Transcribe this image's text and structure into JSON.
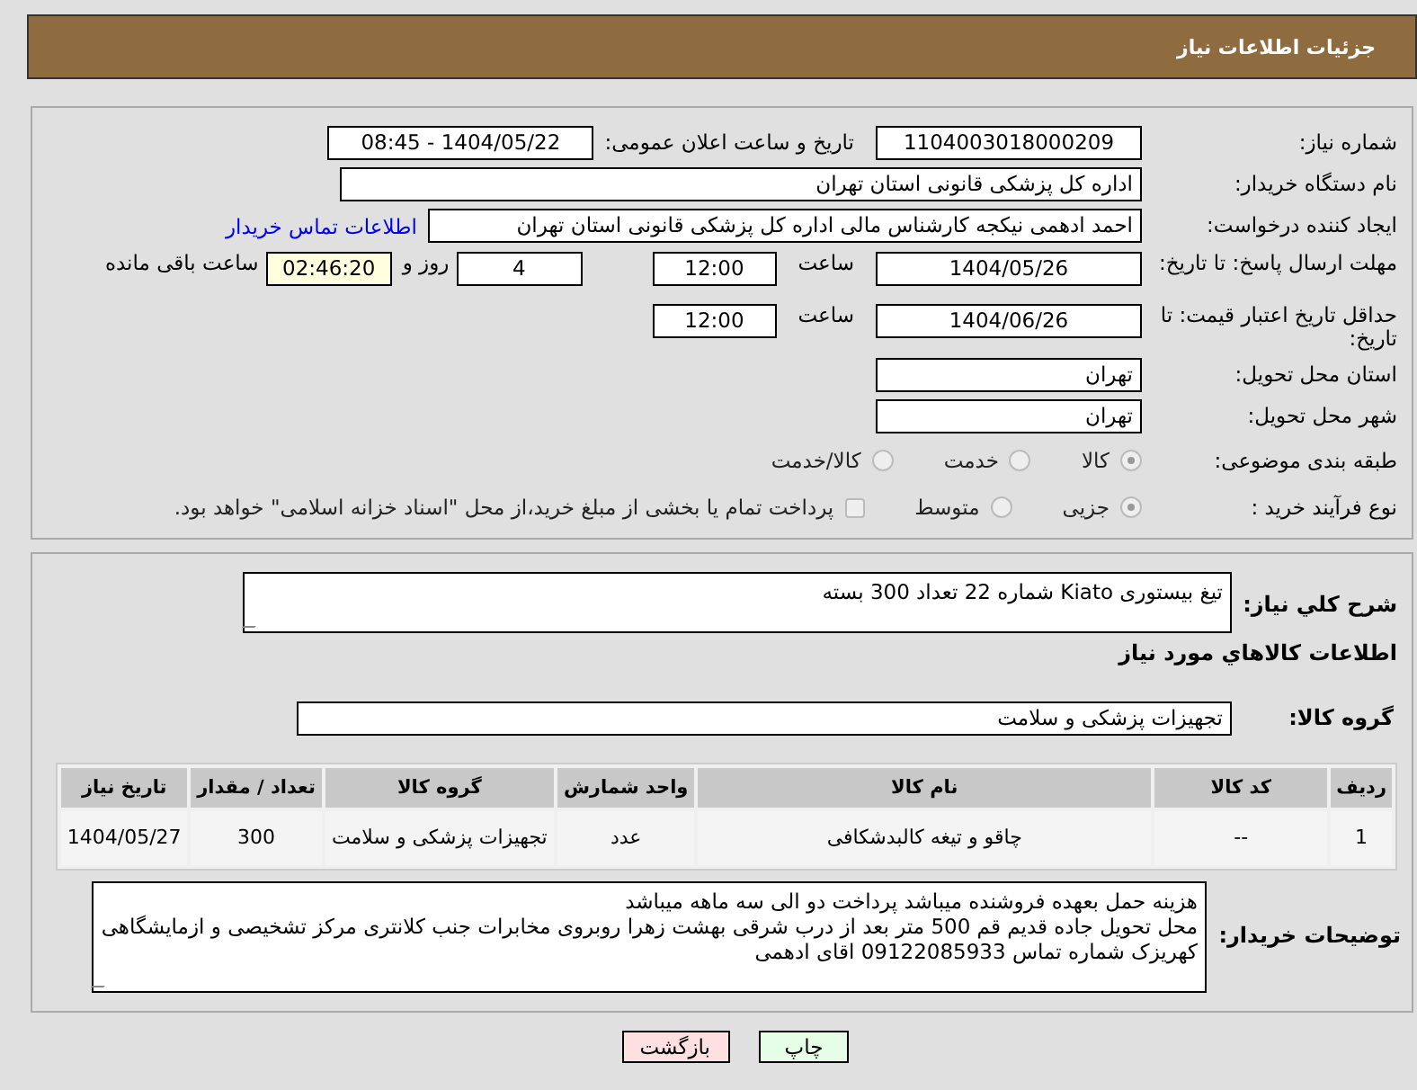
{
  "header": {
    "title": "جزئیات اطلاعات نیاز"
  },
  "need_number": {
    "label": "شماره نیاز:",
    "value": "1104003018000209"
  },
  "announce": {
    "label": "تاریخ و ساعت اعلان عمومی:",
    "value": "1404/05/22 - 08:45"
  },
  "buyer": {
    "label": "نام دستگاه خریدار:",
    "value": "اداره کل پزشکی قانونی استان تهران"
  },
  "requester": {
    "label": "ایجاد کننده درخواست:",
    "value": "احمد ادهمی نیکجه کارشناس مالی اداره کل پزشکی قانونی استان تهران",
    "link": "اطلاعات تماس خریدار"
  },
  "deadline": {
    "label": "مهلت ارسال پاسخ: تا تاریخ:",
    "date": "1404/05/26",
    "time_label": "ساعت",
    "time": "12:00",
    "days": "4",
    "days_label": "روز و",
    "remaining": "02:46:20",
    "remaining_label": "ساعت باقی مانده"
  },
  "validity": {
    "label": "حداقل تاریخ اعتبار قیمت: تا تاریخ:",
    "date": "1404/06/26",
    "time_label": "ساعت",
    "time": "12:00"
  },
  "province": {
    "label": "استان محل تحویل:",
    "value": "تهران"
  },
  "city": {
    "label": "شهر محل تحویل:",
    "value": "تهران"
  },
  "category": {
    "label": "طبقه بندی موضوعی:",
    "options": [
      {
        "label": "کالا",
        "selected": true
      },
      {
        "label": "خدمت",
        "selected": false
      },
      {
        "label": "کالا/خدمت",
        "selected": false
      }
    ]
  },
  "process": {
    "label": "نوع فرآیند خرید :",
    "options": [
      {
        "label": "جزیی",
        "selected": true
      },
      {
        "label": "متوسط",
        "selected": false
      }
    ],
    "payment": {
      "label": "پرداخت تمام یا بخشی از مبلغ خرید،از محل \"اسناد خزانه اسلامی\" خواهد بود.",
      "checked": false
    }
  },
  "description": {
    "label": "شرح کلي نياز:",
    "value": "تیغ بیستوری Kiato شماره 22 تعداد 300 بسته"
  },
  "goods_title": "اطلاعات کالاهاي مورد نياز",
  "goods_group": {
    "label": "گروه کالا:",
    "value": "تجهیزات پزشکی و سلامت"
  },
  "table": {
    "columns": [
      "ردیف",
      "کد کالا",
      "نام کالا",
      "واحد شمارش",
      "گروه کالا",
      "تعداد / مقدار",
      "تاریخ نیاز"
    ],
    "rows": [
      [
        "1",
        "--",
        "چاقو و تیغه کالبدشکافی",
        "عدد",
        "تجهیزات پزشکی و سلامت",
        "300",
        "1404/05/27"
      ]
    ]
  },
  "buyer_notes": {
    "label": "توضیحات خریدار:",
    "lines": [
      "هزینه حمل بعهده فروشنده میباشد پرداخت دو الی سه ماهه میباشد",
      "محل تحویل جاده قدیم قم 500 متر بعد از درب شرقی بهشت زهرا روبروی مخابرات جنب کلانتری مرکز تشخیصی و ازمایشگاهی کهریزک شماره تماس 09122085933 اقای ادهمی"
    ]
  },
  "buttons": [
    {
      "kind": "print",
      "label": "چاپ"
    },
    {
      "kind": "back",
      "label": "بازگشت"
    }
  ]
}
